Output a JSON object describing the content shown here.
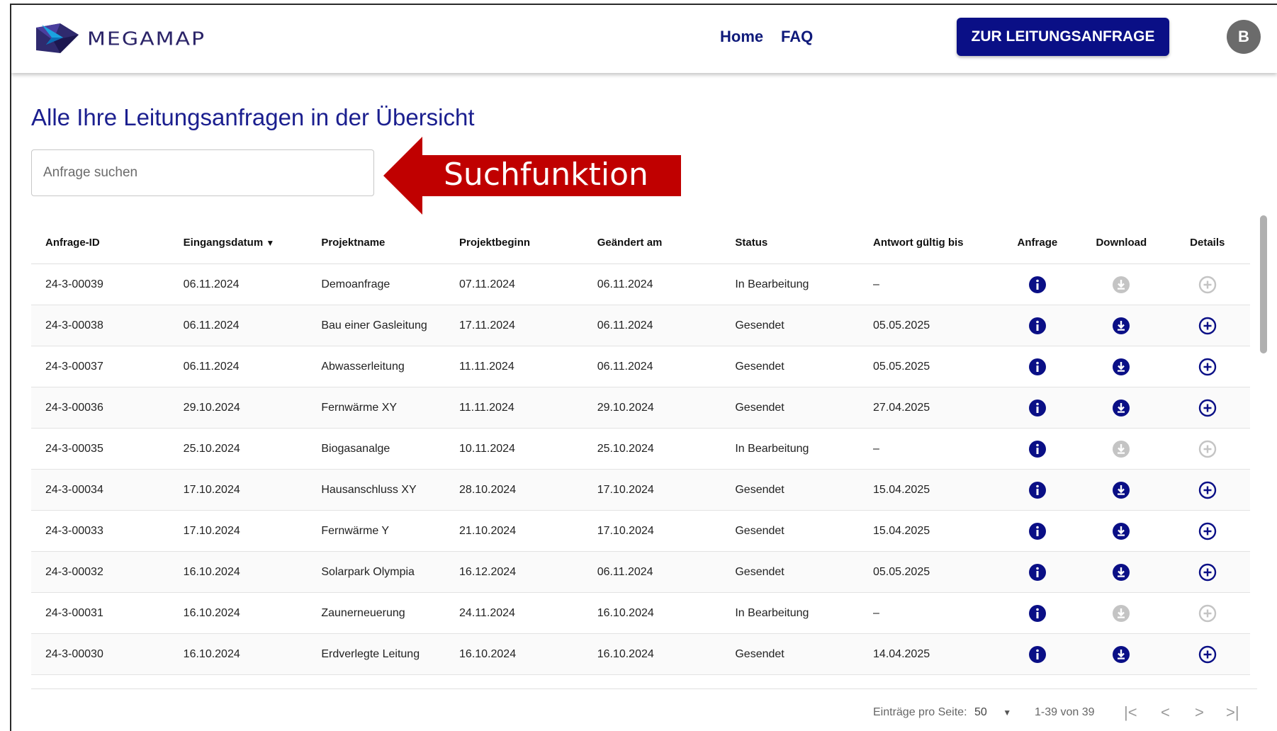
{
  "navbar": {
    "brand": "MEGAMAP",
    "home_label": "Home",
    "faq_label": "FAQ",
    "cta_label": "ZUR LEITUNGSANFRAGE",
    "avatar_initial": "B",
    "brand_color": "#0a0f86"
  },
  "page": {
    "title": "Alle Ihre Leitungsanfragen in der Übersicht"
  },
  "search": {
    "placeholder": "Anfrage suchen",
    "value": ""
  },
  "annotation": {
    "label": "Suchfunktion",
    "color": "#c00000"
  },
  "table": {
    "headers": {
      "id": "Anfrage-ID",
      "eingang": "Eingangsdatum",
      "sort_indicator": "▼",
      "projekt": "Projektname",
      "beginn": "Projektbeginn",
      "geaendert": "Geändert am",
      "status": "Status",
      "antwort": "Antwort gültig bis",
      "anfrage": "Anfrage",
      "download": "Download",
      "details": "Details"
    },
    "rows": [
      {
        "id": "24-3-00039",
        "eingang": "06.11.2024",
        "projekt": "Demoanfrage",
        "beginn": "07.11.2024",
        "geaendert": "06.11.2024",
        "status": "In Bearbeitung",
        "antwort": "–",
        "enabled": false
      },
      {
        "id": "24-3-00038",
        "eingang": "06.11.2024",
        "projekt": "Bau einer Gasleitung",
        "beginn": "17.11.2024",
        "geaendert": "06.11.2024",
        "status": "Gesendet",
        "antwort": "05.05.2025",
        "enabled": true
      },
      {
        "id": "24-3-00037",
        "eingang": "06.11.2024",
        "projekt": "Abwasserleitung",
        "beginn": "11.11.2024",
        "geaendert": "06.11.2024",
        "status": "Gesendet",
        "antwort": "05.05.2025",
        "enabled": true
      },
      {
        "id": "24-3-00036",
        "eingang": "29.10.2024",
        "projekt": "Fernwärme XY",
        "beginn": "11.11.2024",
        "geaendert": "29.10.2024",
        "status": "Gesendet",
        "antwort": "27.04.2025",
        "enabled": true
      },
      {
        "id": "24-3-00035",
        "eingang": "25.10.2024",
        "projekt": "Biogasanalge",
        "beginn": "10.11.2024",
        "geaendert": "25.10.2024",
        "status": "In Bearbeitung",
        "antwort": "–",
        "enabled": false
      },
      {
        "id": "24-3-00034",
        "eingang": "17.10.2024",
        "projekt": "Hausanschluss XY",
        "beginn": "28.10.2024",
        "geaendert": "17.10.2024",
        "status": "Gesendet",
        "antwort": "15.04.2025",
        "enabled": true
      },
      {
        "id": "24-3-00033",
        "eingang": "17.10.2024",
        "projekt": "Fernwärme Y",
        "beginn": "21.10.2024",
        "geaendert": "17.10.2024",
        "status": "Gesendet",
        "antwort": "15.04.2025",
        "enabled": true
      },
      {
        "id": "24-3-00032",
        "eingang": "16.10.2024",
        "projekt": "Solarpark Olympia",
        "beginn": "16.12.2024",
        "geaendert": "06.11.2024",
        "status": "Gesendet",
        "antwort": "05.05.2025",
        "enabled": true
      },
      {
        "id": "24-3-00031",
        "eingang": "16.10.2024",
        "projekt": "Zaunerneuerung",
        "beginn": "24.11.2024",
        "geaendert": "16.10.2024",
        "status": "In Bearbeitung",
        "antwort": "–",
        "enabled": false
      },
      {
        "id": "24-3-00030",
        "eingang": "16.10.2024",
        "projekt": "Erdverlegte Leitung",
        "beginn": "16.10.2024",
        "geaendert": "16.10.2024",
        "status": "Gesendet",
        "antwort": "14.04.2025",
        "enabled": true
      }
    ],
    "icons": {
      "anfrage": "info-icon",
      "download": "download-icon",
      "details": "add-circle-icon",
      "active_color": "#0a0f86",
      "disabled_color": "#c4c4c4"
    }
  },
  "pagination": {
    "per_page_label": "Einträge pro Seite:",
    "per_page_value": "50",
    "range": "1-39 von 39",
    "first_icon": "first-page-icon",
    "prev_icon": "chevron-left-icon",
    "next_icon": "chevron-right-icon",
    "last_icon": "last-page-icon"
  }
}
